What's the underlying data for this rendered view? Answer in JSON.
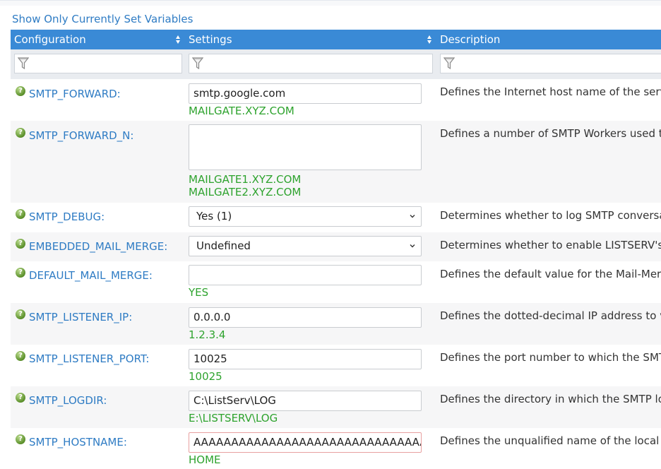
{
  "show_only_link": "Show Only Currently Set Variables",
  "columns": {
    "configuration": "Configuration",
    "settings": "Settings",
    "description": "Description"
  },
  "rows": [
    {
      "name": "SMTP_FORWARD:",
      "control": "input",
      "value": "smtp.google.com",
      "defaults": [
        "MAILGATE.XYZ.COM"
      ],
      "description": "Defines the Internet host name of the serv"
    },
    {
      "name": "SMTP_FORWARD_N:",
      "control": "textarea",
      "value": "",
      "defaults": [
        "MAILGATE1.XYZ.COM",
        "MAILGATE2.XYZ.COM"
      ],
      "description": "Defines a number of SMTP Workers used t"
    },
    {
      "name": "SMTP_DEBUG:",
      "control": "select",
      "value": "Yes (1)",
      "defaults": [],
      "description": "Determines whether to log SMTP conversa"
    },
    {
      "name": "EMBEDDED_MAIL_MERGE:",
      "control": "select",
      "value": "Undefined",
      "defaults": [],
      "description": "Determines whether to enable LISTSERV's"
    },
    {
      "name": "DEFAULT_MAIL_MERGE:",
      "control": "input",
      "value": "",
      "defaults": [
        "YES"
      ],
      "description": "Defines the default value for the Mail-Merg"
    },
    {
      "name": "SMTP_LISTENER_IP:",
      "control": "input",
      "value": "0.0.0.0",
      "defaults": [
        "1.2.3.4"
      ],
      "description": "Defines the dotted-decimal IP address to v"
    },
    {
      "name": "SMTP_LISTENER_PORT:",
      "control": "input",
      "value": "10025",
      "defaults": [
        "10025"
      ],
      "description": "Defines the port number to which the SMT"
    },
    {
      "name": "SMTP_LOGDIR:",
      "control": "input",
      "value": "C:\\ListServ\\LOG",
      "defaults": [
        "E:\\LISTSERV\\LOG"
      ],
      "description": "Defines the directory in which the SMTP lo"
    },
    {
      "name": "SMTP_HOSTNAME:",
      "control": "input",
      "value": "AAAAAAAAAAAAAAAAAAAAAAAAAAAAAAAAAA",
      "defaults": [
        "HOME"
      ],
      "description": "Defines the unqualified name of the local s"
    }
  ],
  "colors": {
    "header_bg": "#3a8ad6",
    "link": "#2f7cc4",
    "default_text": "#2ea32e",
    "help_icon": "#5a8f2a"
  },
  "icons": {
    "help": "question-icon",
    "filter": "funnel-icon",
    "sort": "sort-icon",
    "dropdown": "chevron-down-icon"
  }
}
